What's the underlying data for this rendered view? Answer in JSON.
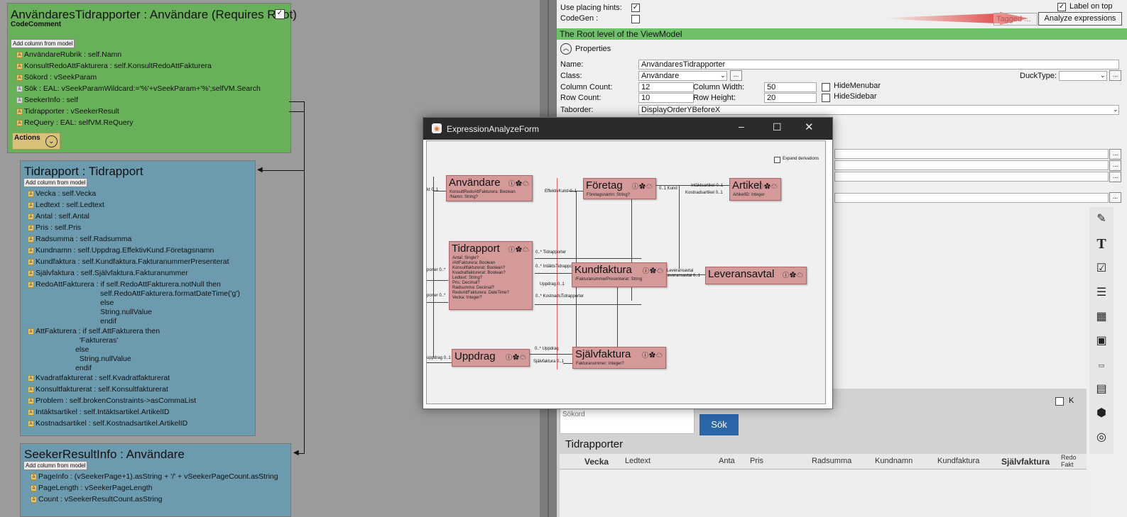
{
  "left": {
    "root": {
      "title": "AnvändaresTidrapporter : Användare  (Requires Root)",
      "comment": "CodeComment",
      "add": "Add column from model",
      "actions": "Actions",
      "attrs": [
        "AnvändareRubrik : self.Namn",
        "KonsultRedoAttFakturera : self.KonsultRedoAttFakturera",
        "Sökord : vSeekParam",
        "Sök : EAL: vSeekParamWildcard:='%'+vSeekParam+'%';selfVM.Search",
        "SeekerInfo : self",
        "Tidrapporter : vSeekerResult",
        "ReQuery : EAL: selfVM.ReQuery"
      ]
    },
    "tid": {
      "title": "Tidrapport : Tidrapport",
      "add": "Add column from model",
      "attrs": [
        "Vecka : self.Vecka",
        "Ledtext : self.Ledtext",
        "Antal : self.Antal",
        "Pris : self.Pris",
        "Radsumma : self.Radsumma",
        "Kundnamn : self.Uppdrag.EffektivKund.Företagsnamn",
        "Kundfaktura : self.Kundfaktura.FakturanummerPresenterat",
        "Självfaktura : self.Självfaktura.Fakturanummer",
        "RedoAttFakturera : if self.RedoAttFakturera.notNull then\n                                   self.RedoAttFakturera.formatDateTime('g')\n                                   else\n                                   String.nullValue\n                                   endif",
        "AttFakturera : if self.AttFakturera then\n                         'Faktureras'\n                       else\n                         String.nullValue\n                       endif",
        "Kvadratfakturerat : self.Kvadratfakturerat",
        "Konsultfakturerat : self.Konsultfakturerat",
        "Problem : self.brokenConstraints->asCommaList",
        "Intäktsartikel : self.Intäktsartikel.ArtikelID",
        "Kostnadsartikel : self.Kostnadsartikel.ArtikelID"
      ]
    },
    "seek": {
      "title": "SeekerResultInfo : Användare",
      "add": "Add column from model",
      "attrs": [
        "PageInfo : (vSeekerPage+1).asString + '/' + vSeekerPageCount.asString",
        "PageLength : vSeekerPageLength",
        "Count : vSeekerResultCount.asString"
      ]
    }
  },
  "right": {
    "use_placing": "Use placing hints:",
    "codegen": "CodeGen :",
    "label_on_top": "Label on top",
    "tagged": "Tagged ...",
    "analyze": "Analyze expressions",
    "root_header": "The Root level of the ViewModel",
    "properties": "Properties",
    "name_lbl": "Name:",
    "name_val": "AnvändaresTidrapporter",
    "class_lbl": "Class:",
    "class_val": "Användare",
    "ducktype_lbl": "DuckType:",
    "colcount_lbl": "Column Count:",
    "colcount_val": "12",
    "colwidth_lbl": "Column Width:",
    "colwidth_val": "50",
    "rowcount_lbl": "Row Count:",
    "rowcount_val": "10",
    "rowheight_lbl": "Row Height:",
    "rowheight_val": "20",
    "hidemenubar": "HideMenubar",
    "hidesidebar": "HideSidebar",
    "taborder_lbl": "Taborder:",
    "taborder_val": "DisplayOrderYBeforeX",
    "sokord": "Sökord",
    "sok": "Sök",
    "tidrapporter": "Tidrapporter",
    "k_label": "K",
    "cols": [
      "Vecka",
      "Ledtext",
      "Anta",
      "Pris",
      "Radsumma",
      "Kundnamn",
      "Kundfaktura",
      "Självfaktura",
      "Redo\nFakt"
    ]
  },
  "dialog": {
    "title": "ExpressionAnalyzeForm",
    "expand": "Expand derivations",
    "classes": {
      "anv": {
        "name": "Användare",
        "attrs": [
          "KonsultRedoAttFakturera: Boolean",
          "/Namn: String?"
        ]
      },
      "for": {
        "name": "Företag",
        "attrs": [
          "Företagsnamn: String?"
        ]
      },
      "art": {
        "name": "Artikel",
        "attrs": [
          "ArtikelID: Integer"
        ]
      },
      "tid": {
        "name": "Tidrapport",
        "attrs": [
          "Antal: Single?",
          "/AttFakturera: Boolean",
          "Konsultfakturerat: Boolean?",
          "Kvadratfakturerat: Boolean?",
          "Ledtext: String?",
          "Pris: Decimal?",
          "Radsumma: Decimal?",
          "RedoAttFakturera: DateTime?",
          "Vecka: Integer?"
        ]
      },
      "kund": {
        "name": "Kundfaktura",
        "attrs": [
          "/FakturanummerPresenterat: String"
        ]
      },
      "lev": {
        "name": "Leveransavtal",
        "attrs": []
      },
      "upp": {
        "name": "Uppdrag",
        "attrs": []
      },
      "sjalv": {
        "name": "Självfaktura",
        "attrs": [
          "Fakturanummer: Integer?"
        ]
      }
    },
    "roles": [
      "0..1 Kund",
      "Intäktsartikel 0..1",
      "Kostnadsartikel 0..1",
      "EffektivKund 0..1",
      "0..* Tidrapporter",
      "0..* IntäktsTidrapporter",
      "0..* KostnadsTidrapporter",
      "Leveransavtal",
      "Leveransavtal 0..1",
      "0..* Uppdrag",
      "Självfaktura 0..1",
      "Uppdrag 0..1",
      "kt 0..1",
      "porter 0..*",
      "porter 0..*",
      "uppdrag 0..1"
    ]
  }
}
